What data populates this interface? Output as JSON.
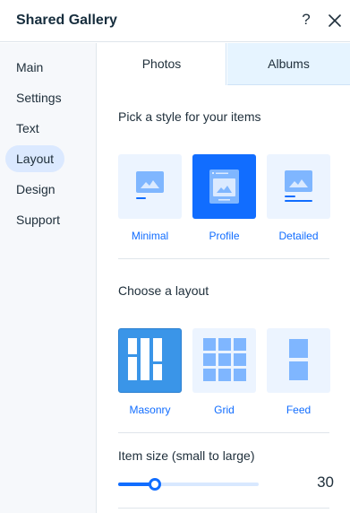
{
  "header": {
    "title": "Shared Gallery",
    "help_label": "?"
  },
  "sidebar": {
    "items": [
      {
        "label": "Main",
        "active": false
      },
      {
        "label": "Settings",
        "active": false
      },
      {
        "label": "Text",
        "active": false
      },
      {
        "label": "Layout",
        "active": true
      },
      {
        "label": "Design",
        "active": false
      },
      {
        "label": "Support",
        "active": false
      }
    ]
  },
  "tabs": [
    {
      "label": "Photos",
      "active": true
    },
    {
      "label": "Albums",
      "active": false
    }
  ],
  "style_section": {
    "label": "Pick a style for your items",
    "options": [
      {
        "label": "Minimal",
        "selected": false
      },
      {
        "label": "Profile",
        "selected": true
      },
      {
        "label": "Detailed",
        "selected": false
      }
    ]
  },
  "layout_section": {
    "label": "Choose a layout",
    "options": [
      {
        "label": "Masonry",
        "selected": true
      },
      {
        "label": "Grid",
        "selected": false
      },
      {
        "label": "Feed",
        "selected": false
      }
    ]
  },
  "item_size": {
    "label": "Item size (small to large)",
    "value": "30",
    "fraction": 0.26
  },
  "colors": {
    "accent": "#116dff",
    "tile_bg": "#ecf4ff",
    "icon_light": "#7fb6ff",
    "masonry_selected": "#3a95e8"
  }
}
